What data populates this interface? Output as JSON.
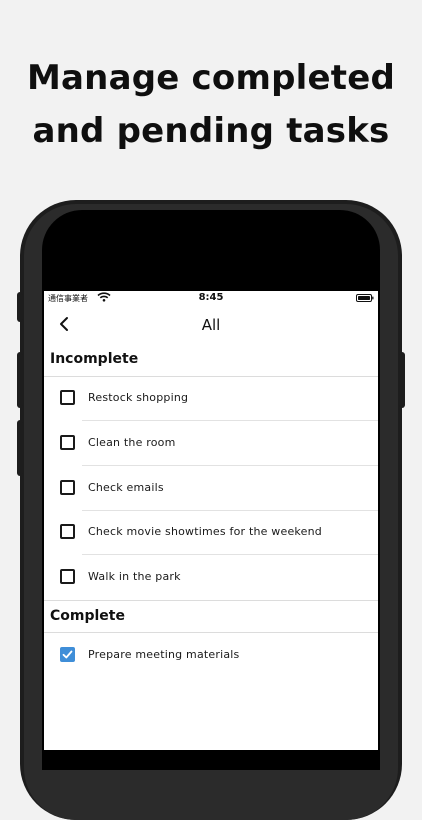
{
  "headline": {
    "line1": "Manage completed",
    "line2": "and pending tasks"
  },
  "status_bar": {
    "carrier": "通信事業者",
    "time": "8:45",
    "wifi_icon": "wifi-icon",
    "battery_icon": "battery-icon"
  },
  "nav": {
    "back_icon": "chevron-left-icon",
    "title": "All"
  },
  "sections": {
    "incomplete": {
      "title": "Incomplete",
      "items": [
        {
          "label": "Restock shopping",
          "checked": false
        },
        {
          "label": "Clean the room",
          "checked": false
        },
        {
          "label": "Check emails",
          "checked": false
        },
        {
          "label": "Check movie showtimes for the weekend",
          "checked": false
        },
        {
          "label": "Walk in the park",
          "checked": false
        }
      ]
    },
    "complete": {
      "title": "Complete",
      "items": [
        {
          "label": "Prepare meeting materials",
          "checked": true
        }
      ]
    }
  },
  "colors": {
    "checkbox_checked": "#3f8ed8",
    "background": "#f2f2f2"
  }
}
